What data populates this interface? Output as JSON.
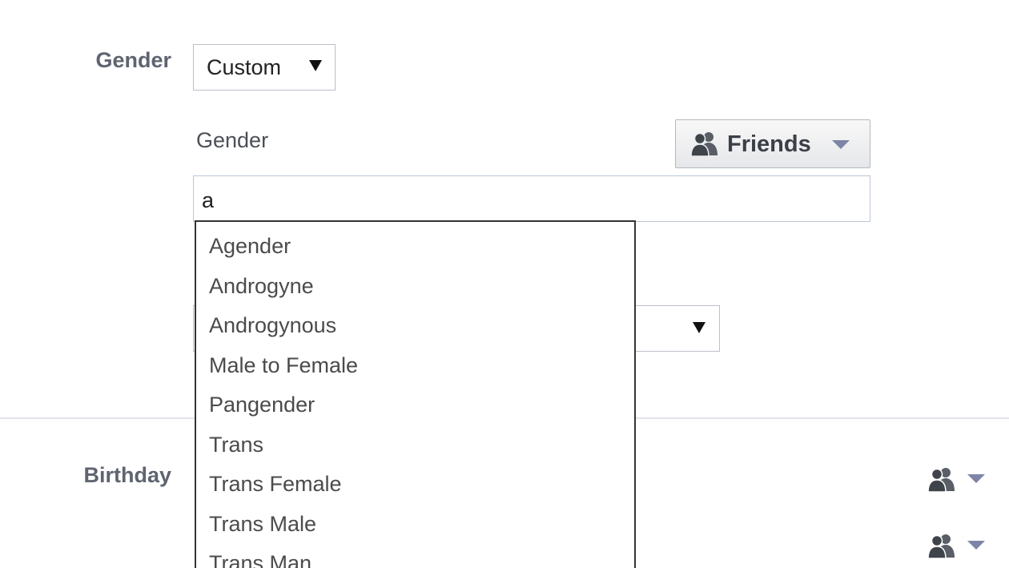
{
  "gender_row": {
    "label": "Gender",
    "select_value": "Custom"
  },
  "custom_gender": {
    "label": "Gender",
    "audience_button": {
      "label": "Friends",
      "icon": "friends-icon"
    },
    "input_value": "a"
  },
  "suggestions": [
    "Agender",
    "Androgyne",
    "Androgynous",
    "Male to Female",
    "Pangender",
    "Trans",
    "Trans Female",
    "Trans Male",
    "Trans Man"
  ],
  "birthday_row": {
    "label": "Birthday",
    "audience_icons": [
      "friends-icon",
      "friends-icon"
    ]
  },
  "colors": {
    "label_gray": "#5f6470",
    "caret_blue": "#7d84a6",
    "input_border": "#bdc7d8",
    "dropdown_border": "#333333"
  }
}
